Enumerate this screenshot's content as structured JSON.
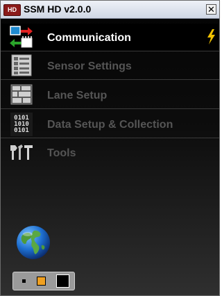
{
  "window": {
    "title": "SSM HD v2.0.0",
    "app_icon_text": "HD",
    "close_glyph": "✕"
  },
  "nav": {
    "items": [
      {
        "label": "Communication",
        "icon": "communication-icon",
        "active": true,
        "status_icon": "lightning-bolt-icon"
      },
      {
        "label": "Sensor Settings",
        "icon": "sensor-settings-icon",
        "active": false
      },
      {
        "label": "Lane Setup",
        "icon": "lane-setup-icon",
        "active": false
      },
      {
        "label": "Data Setup & Collection",
        "icon": "data-binary-icon",
        "active": false
      },
      {
        "label": "Tools",
        "icon": "tools-icon",
        "active": false
      }
    ]
  },
  "footer": {
    "globe_icon": "globe-icon",
    "themes": [
      {
        "name": "small-theme",
        "color": "#000000"
      },
      {
        "name": "medium-theme",
        "color": "#f0a020"
      },
      {
        "name": "large-theme",
        "color": "#000000"
      }
    ]
  },
  "colors": {
    "active_text": "#ffffff",
    "inactive_text": "#555555",
    "accent": "#f0c000"
  }
}
